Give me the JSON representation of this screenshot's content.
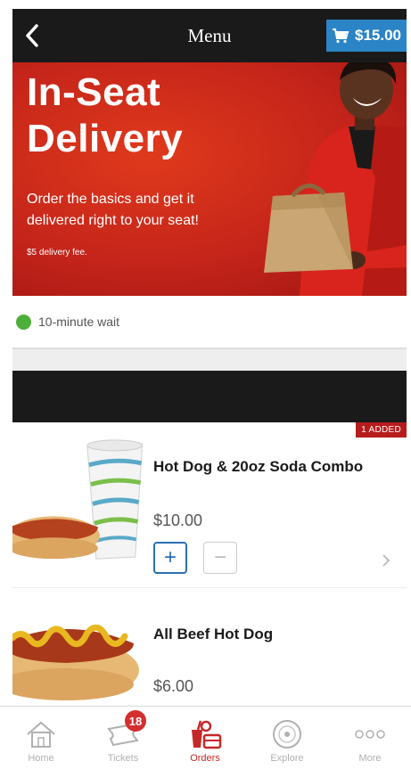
{
  "nav": {
    "title": "Menu",
    "cart_total": "$15.00"
  },
  "hero": {
    "title_line1": "In-Seat",
    "title_line2": "Delivery",
    "subtitle": "Order the basics and get it delivered right to your seat!",
    "fee_note": "$5 delivery fee."
  },
  "wait": {
    "text": "10-minute wait",
    "status_color": "#4caf3a"
  },
  "items": [
    {
      "name": "Hot Dog & 20oz Soda Combo",
      "price": "$10.00",
      "badge": "1 ADDED",
      "plus_label": "+",
      "minus_label": "−"
    },
    {
      "name": "All Beef Hot Dog",
      "price": "$6.00"
    }
  ],
  "tabs": [
    {
      "label": "Home",
      "icon": "home-icon"
    },
    {
      "label": "Tickets",
      "icon": "ticket-icon",
      "badge": "18"
    },
    {
      "label": "Orders",
      "icon": "food-order-icon",
      "active": true
    },
    {
      "label": "Explore",
      "icon": "explore-icon"
    },
    {
      "label": "More",
      "icon": "more-dots-icon"
    }
  ],
  "colors": {
    "nav_bg": "#1a1a1a",
    "cart_button": "#2a84c6",
    "hero_red": "#c4241a",
    "added_badge": "#b71c1c",
    "active_tab": "#c62828"
  }
}
